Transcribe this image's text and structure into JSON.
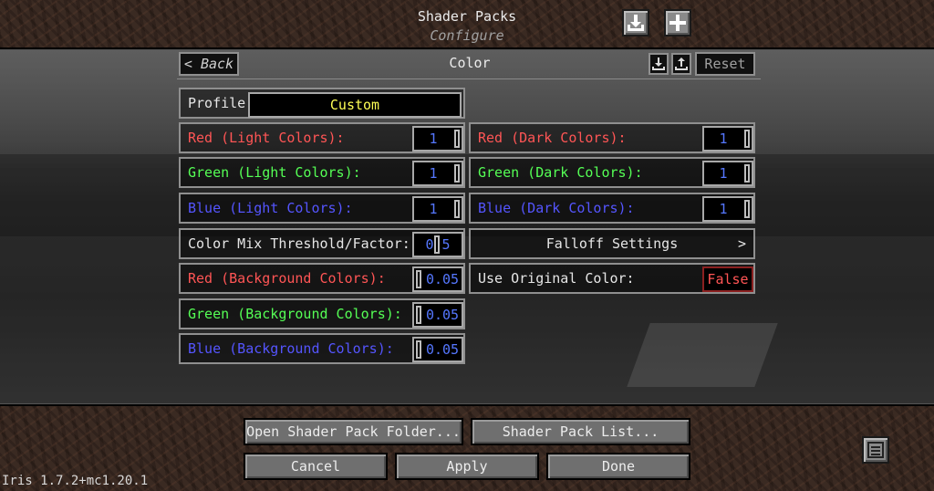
{
  "header": {
    "title": "Shader Packs",
    "subtitle": "Configure",
    "download_icon": "download-icon",
    "add_icon": "plus-icon"
  },
  "nav": {
    "back_label": "< Back",
    "page_title": "Color",
    "import_icon": "import-icon",
    "export_icon": "export-icon",
    "reset_label": "Reset"
  },
  "profile": {
    "label": "Profile:",
    "value": "Custom",
    "value_color": "#ffff55"
  },
  "left_options": [
    {
      "label": "Red (Light Colors):",
      "value": "1",
      "label_color": "#ff5555"
    },
    {
      "label": "Green (Light Colors):",
      "value": "1",
      "label_color": "#55ff55"
    },
    {
      "label": "Blue (Light Colors):",
      "value": "1",
      "label_color": "#5555ff"
    },
    {
      "label": "Color Mix Threshold/Factor:",
      "value": "0.5",
      "label_color": "#e6e6e6"
    },
    {
      "label": "Red (Background Colors):",
      "value": "0.05",
      "label_color": "#ff5555"
    },
    {
      "label": "Green (Background Colors):",
      "value": "0.05",
      "label_color": "#55ff55"
    },
    {
      "label": "Blue (Background Colors):",
      "value": "0.05",
      "label_color": "#5555ff"
    }
  ],
  "right_options": [
    {
      "label": "Red (Dark Colors):",
      "value": "1",
      "label_color": "#ff5555"
    },
    {
      "label": "Green (Dark Colors):",
      "value": "1",
      "label_color": "#55ff55"
    },
    {
      "label": "Blue (Dark Colors):",
      "value": "1",
      "label_color": "#5555ff"
    }
  ],
  "falloff": {
    "label": "Falloff Settings",
    "arrow": ">"
  },
  "use_original": {
    "label": "Use Original Color:",
    "value": "False",
    "value_color": "#ff5555"
  },
  "footer": {
    "open_folder": "Open Shader Pack Folder...",
    "pack_list": "Shader Pack List...",
    "cancel": "Cancel",
    "apply": "Apply",
    "done": "Done",
    "version": "Iris 1.7.2+mc1.20.1",
    "menu_icon": "list-icon"
  },
  "colors": {
    "value_text": "#5577ff",
    "false_text": "#ff5555",
    "custom_text": "#ffff55"
  }
}
